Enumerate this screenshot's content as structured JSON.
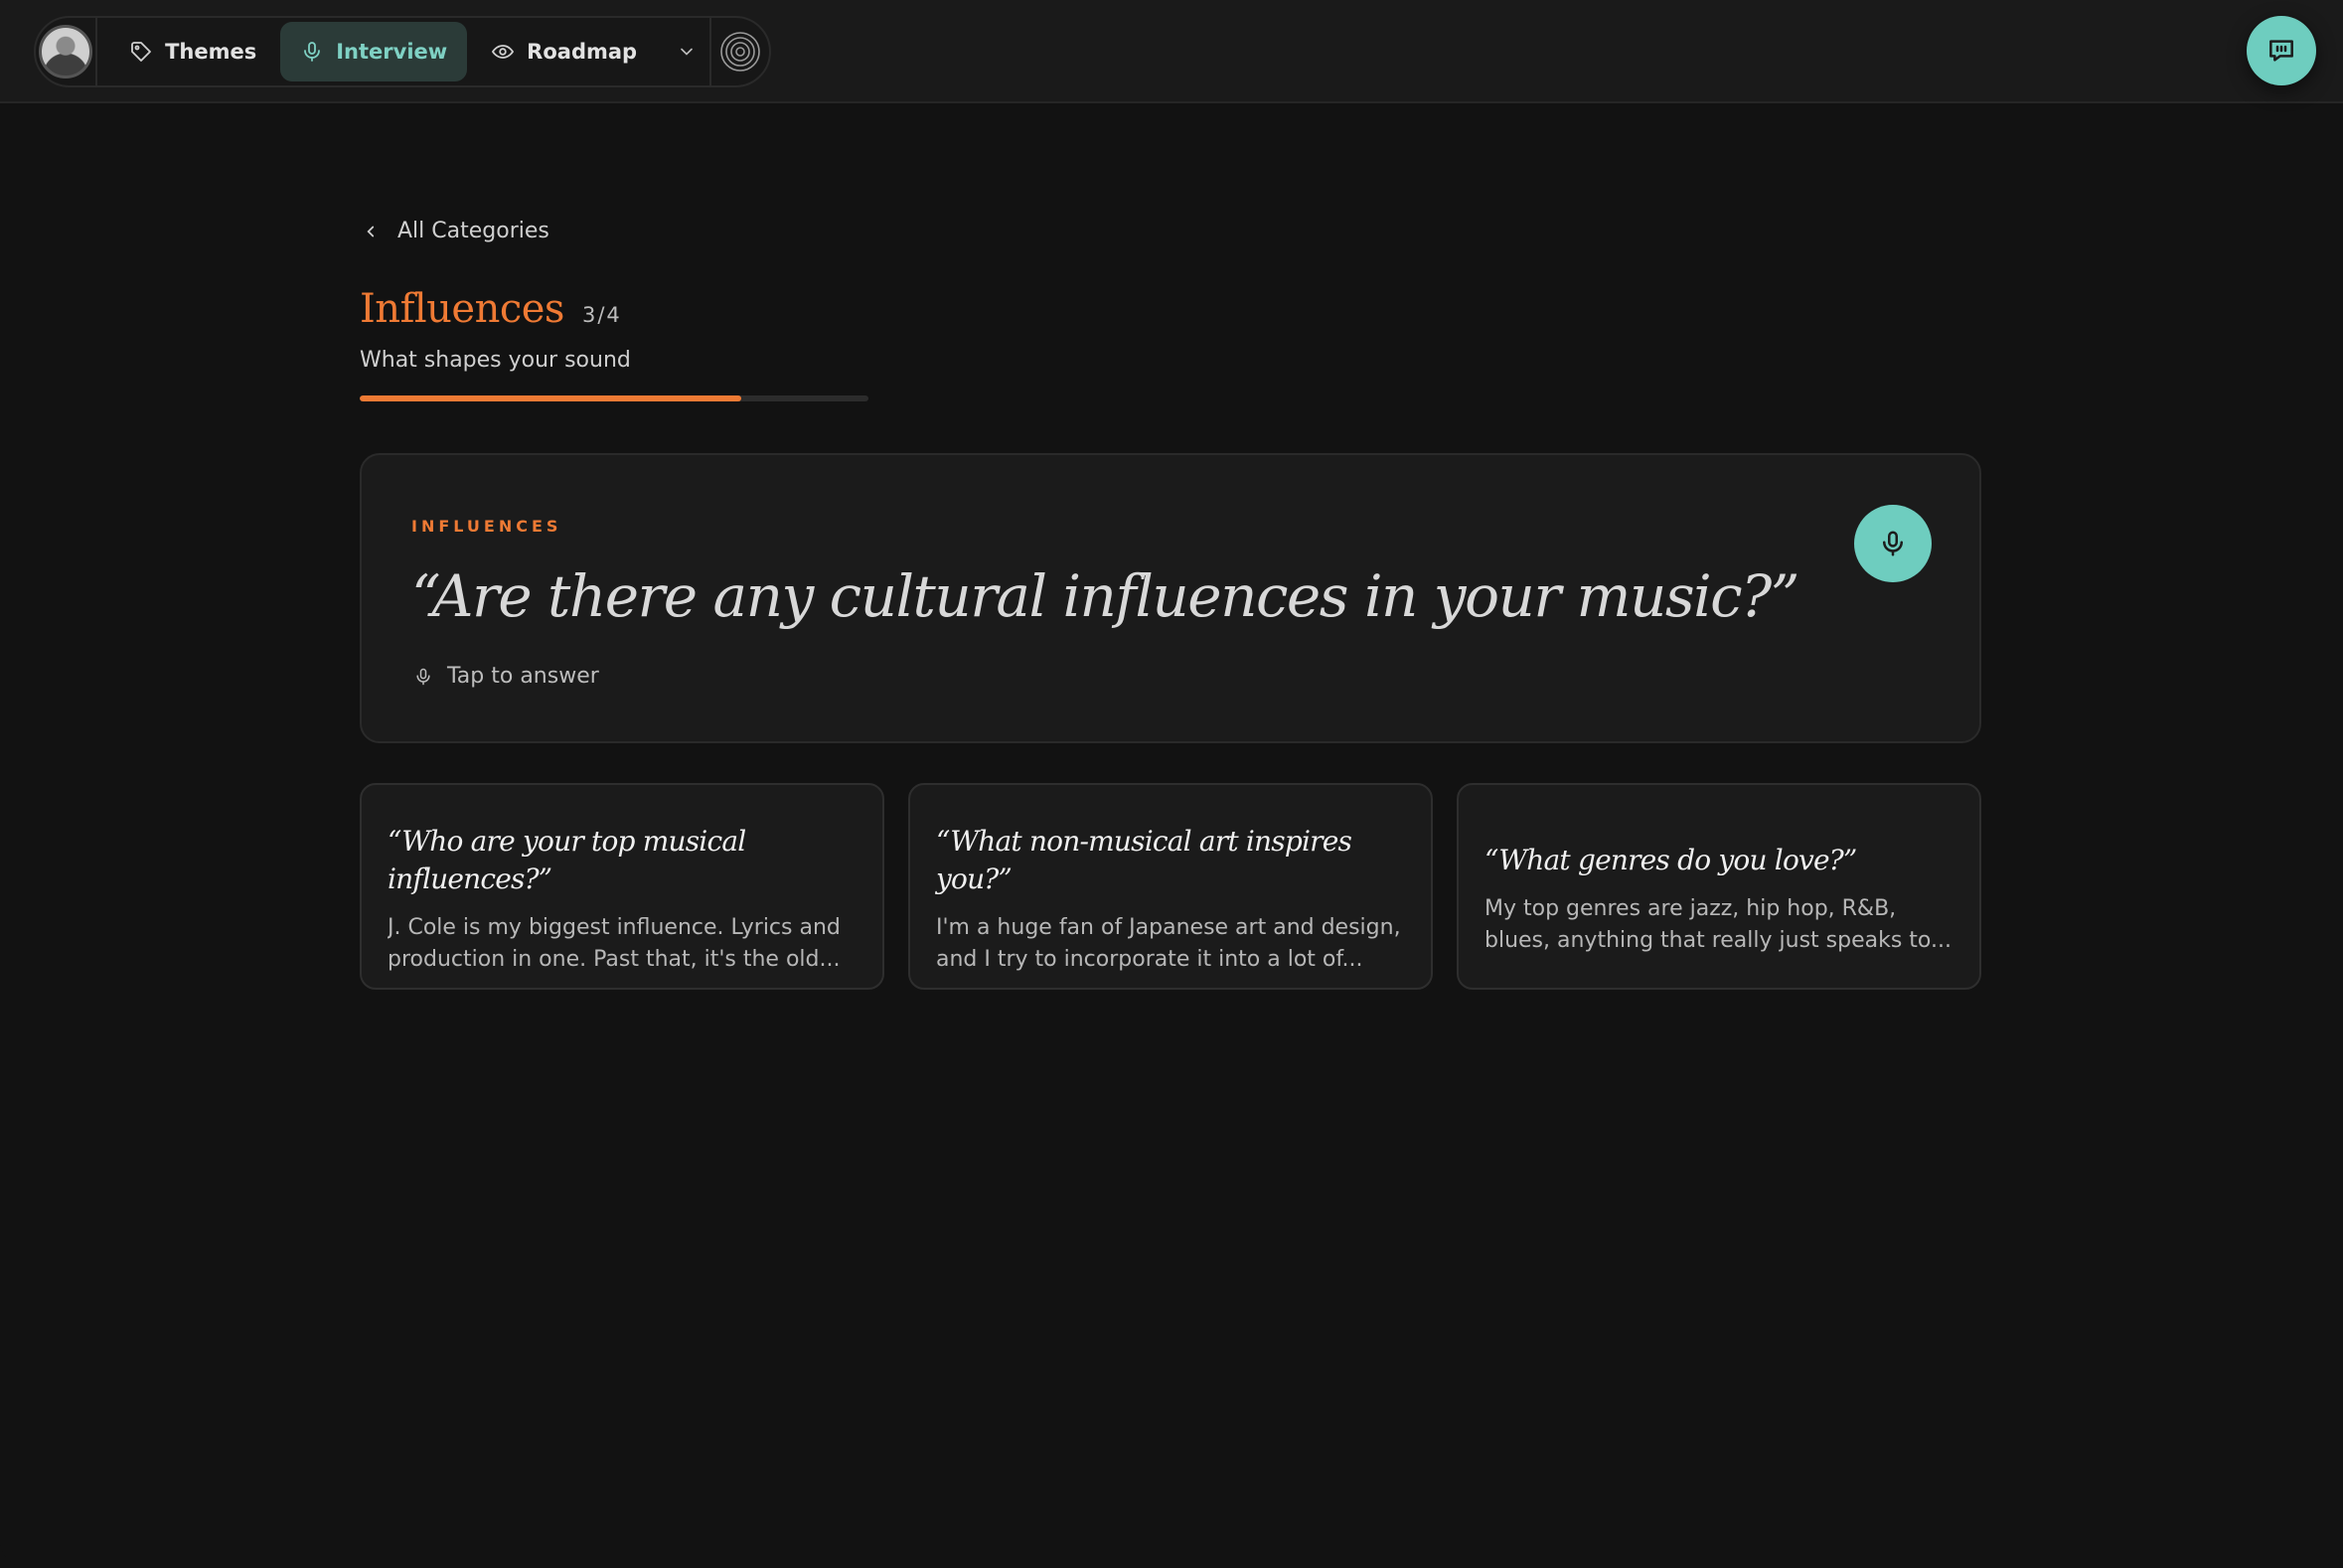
{
  "nav": {
    "items": [
      {
        "label": "Themes",
        "icon": "tag-icon",
        "active": false
      },
      {
        "label": "Interview",
        "icon": "microphone-icon",
        "active": true
      },
      {
        "label": "Roadmap",
        "icon": "eye-icon",
        "active": false
      }
    ]
  },
  "colors": {
    "accent": "#ef7a34",
    "teal": "#6ecdbf",
    "background": "#121212"
  },
  "back_label": "All Categories",
  "category": {
    "title": "Influences",
    "count": "3/4",
    "subtitle": "What shapes your sound",
    "progress_fraction": 0.75
  },
  "question": {
    "label": "INFLUENCES",
    "text": "“Are there any cultural influences in your music?”",
    "tap_label": "Tap to answer"
  },
  "answered": [
    {
      "question": "“Who are your top musical influences?”",
      "answer": "J. Cole is my biggest influence. Lyrics and production in one. Past that, it's the old..."
    },
    {
      "question": "“What non-musical art inspires you?”",
      "answer": "I'm a huge fan of Japanese art and design, and I try to incorporate it into a lot of..."
    },
    {
      "question": "“What genres do you love?”",
      "answer": "My top genres are jazz, hip hop, R&B, blues, anything that really just speaks to..."
    }
  ]
}
